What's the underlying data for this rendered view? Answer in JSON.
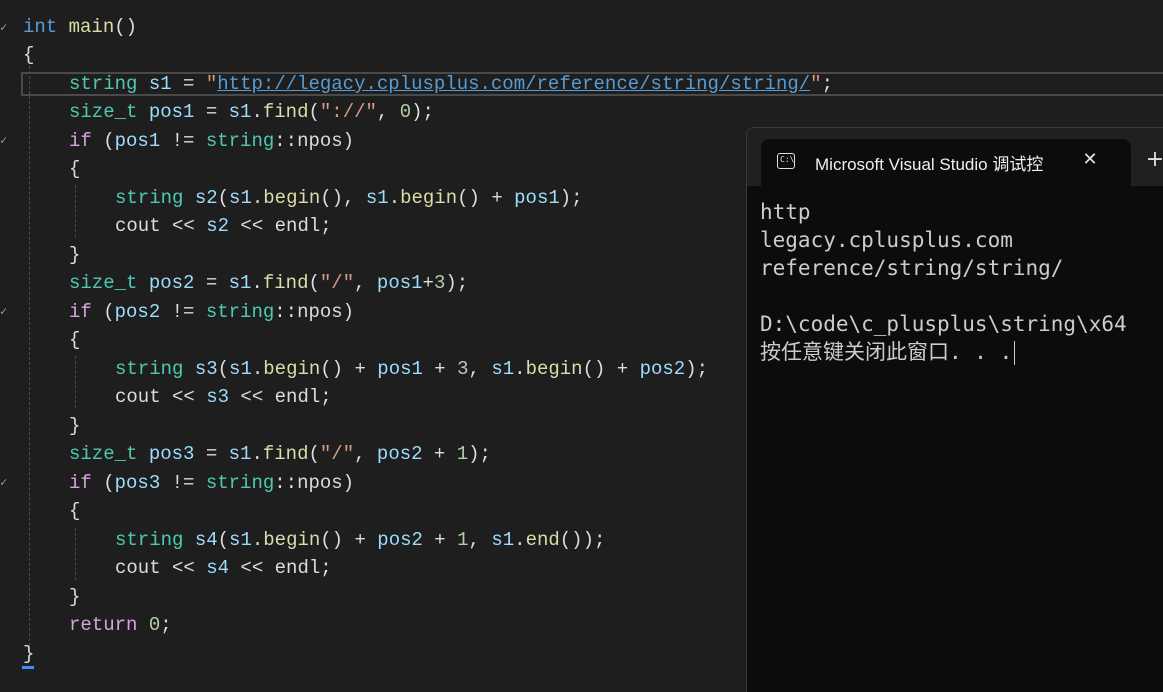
{
  "editor": {
    "lines": [
      {
        "id": "l1",
        "tokens": [
          [
            "kw",
            "int"
          ],
          [
            "plain",
            " "
          ],
          [
            "fn",
            "main"
          ],
          [
            "plain",
            "()"
          ]
        ]
      },
      {
        "id": "l2",
        "tokens": [
          [
            "plain",
            "{"
          ]
        ]
      },
      {
        "id": "l3",
        "tokens": [
          [
            "type",
            "string"
          ],
          [
            "plain",
            " "
          ],
          [
            "var",
            "s1"
          ],
          [
            "plain",
            " = "
          ],
          [
            "str",
            "\""
          ],
          [
            "url",
            "http://legacy.cplusplus.com/reference/string/string/"
          ],
          [
            "str",
            "\""
          ],
          [
            "plain",
            ";"
          ]
        ]
      },
      {
        "id": "l4",
        "tokens": [
          [
            "type",
            "size_t"
          ],
          [
            "plain",
            " "
          ],
          [
            "var",
            "pos1"
          ],
          [
            "plain",
            " = "
          ],
          [
            "var",
            "s1"
          ],
          [
            "plain",
            "."
          ],
          [
            "fn",
            "find"
          ],
          [
            "plain",
            "("
          ],
          [
            "str",
            "\"://\""
          ],
          [
            "plain",
            ", "
          ],
          [
            "num",
            "0"
          ],
          [
            "plain",
            ");"
          ]
        ]
      },
      {
        "id": "l5",
        "tokens": [
          [
            "kw2",
            "if"
          ],
          [
            "plain",
            " ("
          ],
          [
            "var",
            "pos1"
          ],
          [
            "plain",
            " != "
          ],
          [
            "type",
            "string"
          ],
          [
            "plain",
            "::npos)"
          ]
        ]
      },
      {
        "id": "l6",
        "tokens": [
          [
            "plain",
            "{"
          ]
        ]
      },
      {
        "id": "l7",
        "tokens": [
          [
            "type",
            "string"
          ],
          [
            "plain",
            " "
          ],
          [
            "var",
            "s2"
          ],
          [
            "plain",
            "("
          ],
          [
            "var",
            "s1"
          ],
          [
            "plain",
            "."
          ],
          [
            "fn",
            "begin"
          ],
          [
            "plain",
            "(), "
          ],
          [
            "var",
            "s1"
          ],
          [
            "plain",
            "."
          ],
          [
            "fn",
            "begin"
          ],
          [
            "plain",
            "() + "
          ],
          [
            "var",
            "pos1"
          ],
          [
            "plain",
            ");"
          ]
        ]
      },
      {
        "id": "l8",
        "tokens": [
          [
            "plain",
            "cout << "
          ],
          [
            "var",
            "s2"
          ],
          [
            "plain",
            " << endl;"
          ]
        ]
      },
      {
        "id": "l9",
        "tokens": [
          [
            "plain",
            "}"
          ]
        ]
      },
      {
        "id": "l10",
        "tokens": [
          [
            "type",
            "size_t"
          ],
          [
            "plain",
            " "
          ],
          [
            "var",
            "pos2"
          ],
          [
            "plain",
            " = "
          ],
          [
            "var",
            "s1"
          ],
          [
            "plain",
            "."
          ],
          [
            "fn",
            "find"
          ],
          [
            "plain",
            "("
          ],
          [
            "str",
            "\"/\""
          ],
          [
            "plain",
            ", "
          ],
          [
            "var",
            "pos1"
          ],
          [
            "plain",
            "+"
          ],
          [
            "num",
            "3"
          ],
          [
            "plain",
            ");"
          ]
        ]
      },
      {
        "id": "l11",
        "tokens": [
          [
            "kw2",
            "if"
          ],
          [
            "plain",
            " ("
          ],
          [
            "var",
            "pos2"
          ],
          [
            "plain",
            " != "
          ],
          [
            "type",
            "string"
          ],
          [
            "plain",
            "::npos)"
          ]
        ]
      },
      {
        "id": "l12",
        "tokens": [
          [
            "plain",
            "{"
          ]
        ]
      },
      {
        "id": "l13",
        "tokens": [
          [
            "type",
            "string"
          ],
          [
            "plain",
            " "
          ],
          [
            "var",
            "s3"
          ],
          [
            "plain",
            "("
          ],
          [
            "var",
            "s1"
          ],
          [
            "plain",
            "."
          ],
          [
            "fn",
            "begin"
          ],
          [
            "plain",
            "() + "
          ],
          [
            "var",
            "pos1"
          ],
          [
            "plain",
            " + "
          ],
          [
            "num",
            "3"
          ],
          [
            "plain",
            ", "
          ],
          [
            "var",
            "s1"
          ],
          [
            "plain",
            "."
          ],
          [
            "fn",
            "begin"
          ],
          [
            "plain",
            "() + "
          ],
          [
            "var",
            "pos2"
          ],
          [
            "plain",
            ");"
          ]
        ]
      },
      {
        "id": "l14",
        "tokens": [
          [
            "plain",
            "cout << "
          ],
          [
            "var",
            "s3"
          ],
          [
            "plain",
            " << endl;"
          ]
        ]
      },
      {
        "id": "l15",
        "tokens": [
          [
            "plain",
            "}"
          ]
        ]
      },
      {
        "id": "l16",
        "tokens": [
          [
            "type",
            "size_t"
          ],
          [
            "plain",
            " "
          ],
          [
            "var",
            "pos3"
          ],
          [
            "plain",
            " = "
          ],
          [
            "var",
            "s1"
          ],
          [
            "plain",
            "."
          ],
          [
            "fn",
            "find"
          ],
          [
            "plain",
            "("
          ],
          [
            "str",
            "\"/\""
          ],
          [
            "plain",
            ", "
          ],
          [
            "var",
            "pos2"
          ],
          [
            "plain",
            " + "
          ],
          [
            "num",
            "1"
          ],
          [
            "plain",
            ");"
          ]
        ]
      },
      {
        "id": "l17",
        "tokens": [
          [
            "kw2",
            "if"
          ],
          [
            "plain",
            " ("
          ],
          [
            "var",
            "pos3"
          ],
          [
            "plain",
            " != "
          ],
          [
            "type",
            "string"
          ],
          [
            "plain",
            "::npos)"
          ]
        ]
      },
      {
        "id": "l18",
        "tokens": [
          [
            "plain",
            "{"
          ]
        ]
      },
      {
        "id": "l19",
        "tokens": [
          [
            "type",
            "string"
          ],
          [
            "plain",
            " "
          ],
          [
            "var",
            "s4"
          ],
          [
            "plain",
            "("
          ],
          [
            "var",
            "s1"
          ],
          [
            "plain",
            "."
          ],
          [
            "fn",
            "begin"
          ],
          [
            "plain",
            "() + "
          ],
          [
            "var",
            "pos2"
          ],
          [
            "plain",
            " + "
          ],
          [
            "num",
            "1"
          ],
          [
            "plain",
            ", "
          ],
          [
            "var",
            "s1"
          ],
          [
            "plain",
            "."
          ],
          [
            "fn",
            "end"
          ],
          [
            "plain",
            "());"
          ]
        ]
      },
      {
        "id": "l20",
        "tokens": [
          [
            "plain",
            "cout << "
          ],
          [
            "var",
            "s4"
          ],
          [
            "plain",
            " << endl;"
          ]
        ]
      },
      {
        "id": "l21",
        "tokens": [
          [
            "plain",
            "}"
          ]
        ]
      },
      {
        "id": "l22",
        "tokens": [
          [
            "kw2",
            "return"
          ],
          [
            "plain",
            " "
          ],
          [
            "num",
            "0"
          ],
          [
            "plain",
            ";"
          ]
        ]
      },
      {
        "id": "l23",
        "tokens": [
          [
            "plain",
            "}"
          ]
        ]
      }
    ]
  },
  "terminal": {
    "tab_title": "Microsoft Visual Studio 调试控",
    "tab_icon": "console-app-icon",
    "tab_icon_glyph": "C:\\",
    "close_glyph": "✕",
    "new_tab_glyph": "+",
    "output": {
      "line1": "http",
      "line2": "legacy.cplusplus.com",
      "line3": "reference/string/string/",
      "line4": "",
      "line5": "D:\\code\\c_plusplus\\string\\x64",
      "line6": "按任意键关闭此窗口. . ."
    }
  }
}
